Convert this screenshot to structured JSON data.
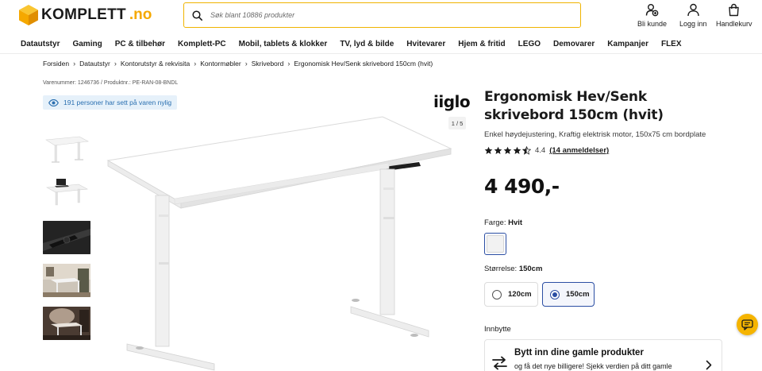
{
  "header": {
    "brand": "KOMPLETT",
    "brand_tld": ".no",
    "search_placeholder": "Søk blant 10886 produkter",
    "account_links": [
      {
        "label": "Bli kunde",
        "icon": "user-plus-icon"
      },
      {
        "label": "Logg inn",
        "icon": "user-icon"
      },
      {
        "label": "Handlekurv",
        "icon": "shopping-bag-icon"
      }
    ]
  },
  "nav": {
    "items": [
      "Datautstyr",
      "Gaming",
      "PC & tilbehør",
      "Komplett-PC",
      "Mobil, tablets & klokker",
      "TV, lyd & bilde",
      "Hvitevarer",
      "Hjem & fritid",
      "LEGO",
      "Demovarer",
      "Kampanjer",
      "FLEX"
    ]
  },
  "breadcrumb": [
    "Forsiden",
    "Datautstyr",
    "Kontorutstyr & rekvisita",
    "Kontormøbler",
    "Skrivebord",
    "Ergonomisk Hev/Senk skrivebord 150cm (hvit)"
  ],
  "product": {
    "sku_text": "Varenummer: 1246736 / Produktnr.: PE-RAN-08-BNDL",
    "viewers_text": "191 personer har sett på varen nylig",
    "brand_logo": "iiglo",
    "image_counter": "1 / 5",
    "title": "Ergonomisk Hev/Senk skrivebord 150cm (hvit)",
    "subtitle": "Enkel høydejustering, Kraftig elektrisk motor, 150x75 cm bordplate",
    "rating": 4.4,
    "rating_text": "4.4",
    "reviews_text": "(14 anmeldelser)",
    "price": "4 490,-",
    "color_label": "Farge:",
    "color_value": "Hvit",
    "size_label": "Størrelse:",
    "size_value": "150cm",
    "sizes": [
      {
        "label": "120cm",
        "selected": false
      },
      {
        "label": "150cm",
        "selected": true
      }
    ],
    "tradein_heading": "Innbytte",
    "tradein_title": "Bytt inn dine gamle produkter",
    "tradein_desc": "og få det nye billigere! Sjekk verdien på ditt gamle"
  },
  "colors": {
    "accent_yellow": "#f5b400",
    "selection_blue": "#2b4ea3",
    "viewers_bg": "#e6f1fa",
    "viewers_text": "#2a6fb0"
  }
}
